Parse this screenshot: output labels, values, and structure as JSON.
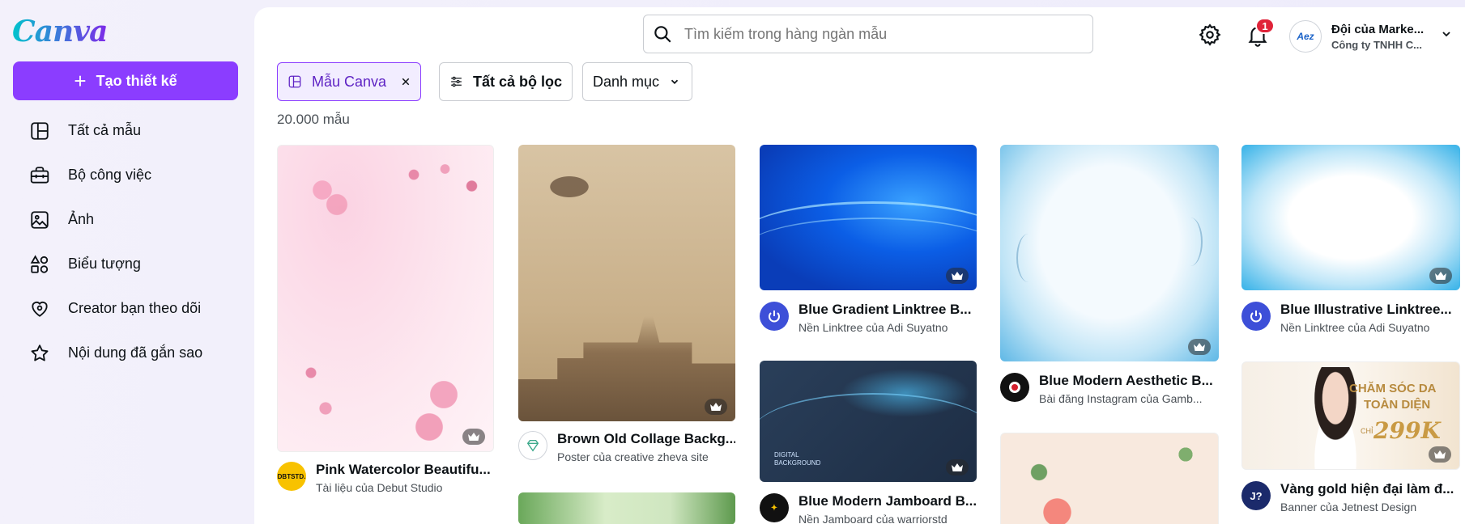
{
  "brand": {
    "logo_text": "Canva"
  },
  "sidebar": {
    "create_label": "Tạo thiết kế",
    "items": [
      {
        "label": "Tất cả mẫu",
        "icon": "template-icon"
      },
      {
        "label": "Bộ công việc",
        "icon": "briefcase-icon"
      },
      {
        "label": "Ảnh",
        "icon": "image-icon"
      },
      {
        "label": "Biểu tượng",
        "icon": "shapes-icon"
      },
      {
        "label": "Creator bạn theo dõi",
        "icon": "heart-icon"
      },
      {
        "label": "Nội dung đã gắn sao",
        "icon": "star-icon"
      }
    ]
  },
  "header": {
    "search_placeholder": "Tìm kiếm trong hàng ngàn mẫu",
    "notification_count": "1",
    "account_name": "Đội của Marke...",
    "account_org": "Công ty TNHH C...",
    "avatar_text": "Aez"
  },
  "filters": {
    "selected_chip": "Mẫu Canva",
    "all_filters": "Tất cả bộ lọc",
    "category": "Danh mục"
  },
  "result_count": "20.000 mẫu",
  "templates": [
    {
      "title": "Pink Watercolor Beautifu...",
      "subtitle": "Tài liệu của Debut Studio",
      "avatar": "DBTSTD."
    },
    {
      "title": "Brown Old Collage Backg...",
      "subtitle": "Poster của creative zheva site",
      "avatar": ""
    },
    {
      "title": "Blue Gradient Linktree B...",
      "subtitle": "Nền Linktree của Adi Suyatno",
      "avatar": ""
    },
    {
      "title": "Blue Modern Jamboard B...",
      "subtitle": "Nền Jamboard của warriorstd",
      "avatar": ""
    },
    {
      "title": "Blue Modern Aesthetic B...",
      "subtitle": "Bài đăng Instagram của Gamb...",
      "avatar": ""
    },
    {
      "title": "Blue Illustrative Linktree...",
      "subtitle": "Nền Linktree của Adi Suyatno",
      "avatar": ""
    },
    {
      "title": "Vàng gold hiện đại làm đ...",
      "subtitle": "Banner của Jetnest Design",
      "avatar": "J?"
    }
  ],
  "thumb_text": {
    "digital_bg": "DIGITAL\nBACKGROUND",
    "cham_soc_1": "CHĂM SÓC DA",
    "cham_soc_2": "TOÀN DIỆN",
    "chi": "CHỈ",
    "price": "299K"
  },
  "colors": {
    "accent": "#8b3dff",
    "badge": "#e0243a"
  }
}
